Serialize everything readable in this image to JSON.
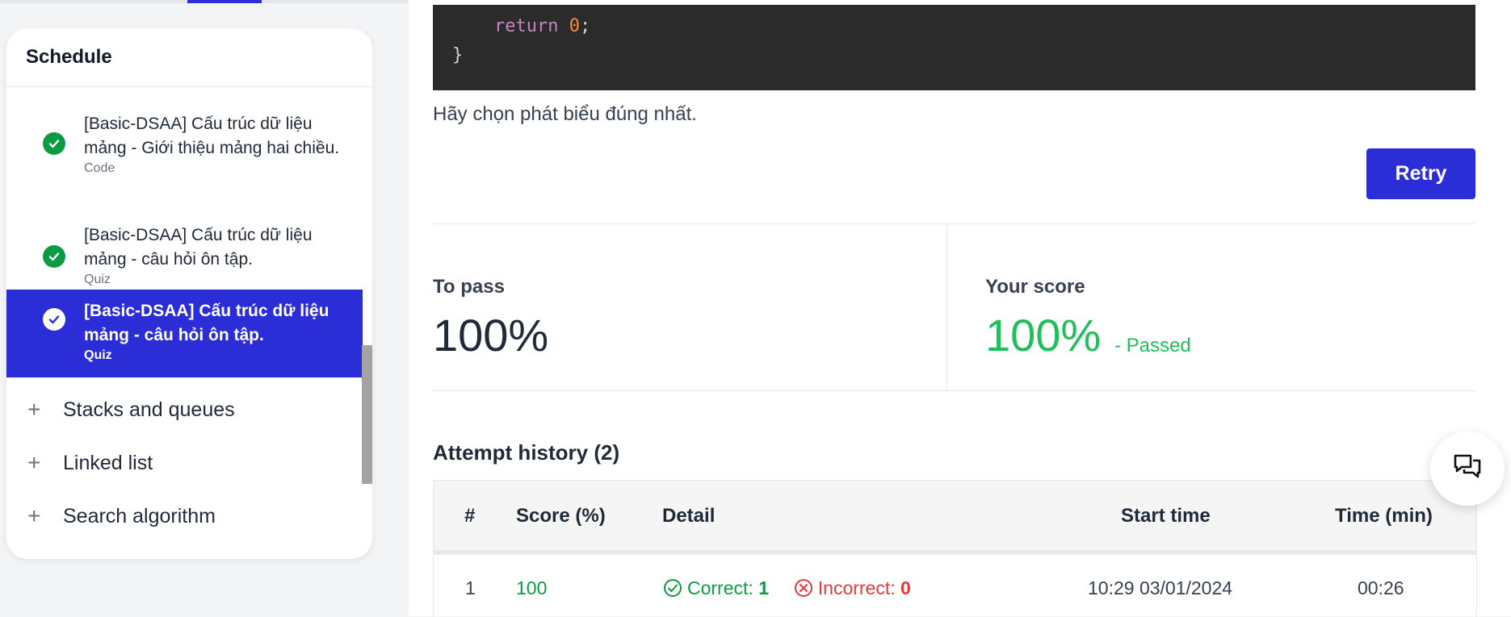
{
  "sidebar": {
    "title": "Schedule",
    "lessons": [
      {
        "title": "[Basic-DSAA] Cấu trúc dữ liệu mảng - Giới thiệu mảng hai chiều.",
        "type": "Code",
        "completed": true,
        "active": false
      },
      {
        "title": "[Basic-DSAA] Cấu trúc dữ liệu mảng - câu hỏi ôn tập.",
        "type": "Quiz",
        "completed": true,
        "active": false
      },
      {
        "title": "[Basic-DSAA] Cấu trúc dữ liệu mảng - câu hỏi ôn tập.",
        "type": "Quiz",
        "completed": true,
        "active": true
      }
    ],
    "sections": [
      {
        "label": "Stacks and queues",
        "icon": "plus-icon"
      },
      {
        "label": "Linked list",
        "icon": "plus-icon"
      },
      {
        "label": "Search algorithm",
        "icon": "plus-icon"
      }
    ]
  },
  "code": {
    "keyword": "return",
    "number": "0",
    "semicolon": ";",
    "closing_brace": "}"
  },
  "question": "Hãy chọn phát biểu đúng nhất.",
  "retry_label": "Retry",
  "result": {
    "to_pass_label": "To pass",
    "to_pass_value": "100%",
    "score_label": "Your score",
    "score_value": "100%",
    "score_status": "- Passed"
  },
  "history": {
    "title": "Attempt history (2)",
    "headers": [
      "#",
      "Score (%)",
      "Detail",
      "Start time",
      "Time (min)"
    ],
    "rows": [
      {
        "index": "1",
        "score": "100",
        "correct_label": "Correct:",
        "correct": "1",
        "incorrect_label": "Incorrect:",
        "incorrect": "0",
        "start_time": "10:29 03/01/2024",
        "duration": "00:26"
      }
    ]
  },
  "colors": {
    "accent": "#2b2ed6",
    "success": "#0a9b43",
    "score_green": "#1fbf5a",
    "error": "#e5383b"
  },
  "chat": {
    "icon": "chat-icon"
  }
}
